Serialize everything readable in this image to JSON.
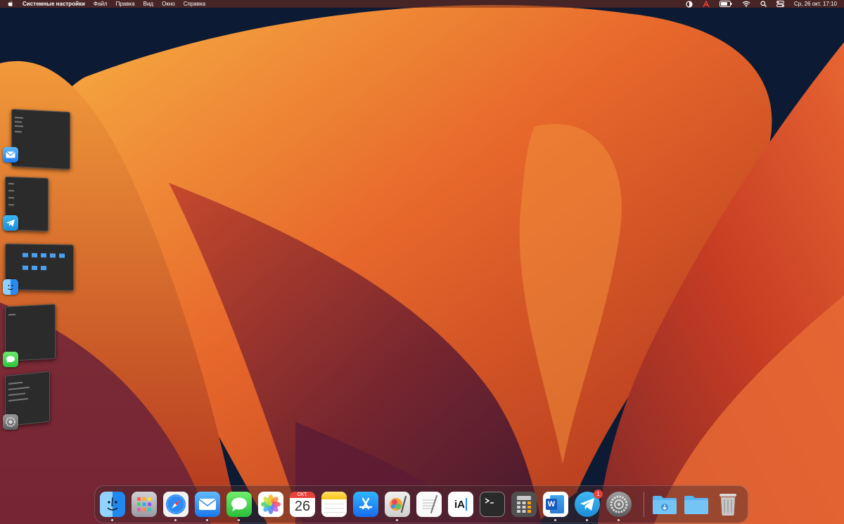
{
  "menubar": {
    "app_name": "Системные настройки",
    "items": [
      "Файл",
      "Правка",
      "Вид",
      "Окно",
      "Справка"
    ],
    "clock": "Ср, 26 окт.  17:10"
  },
  "dock": {
    "calendar": {
      "month": "ОКТ.",
      "day": "26"
    },
    "textedit_label": "iA",
    "telegram_badge": "1",
    "word_letter": "W"
  },
  "colors": {
    "accent_blue": "#1e88ff",
    "badge_red": "#e8413a",
    "menubar": "#7a2d19"
  }
}
